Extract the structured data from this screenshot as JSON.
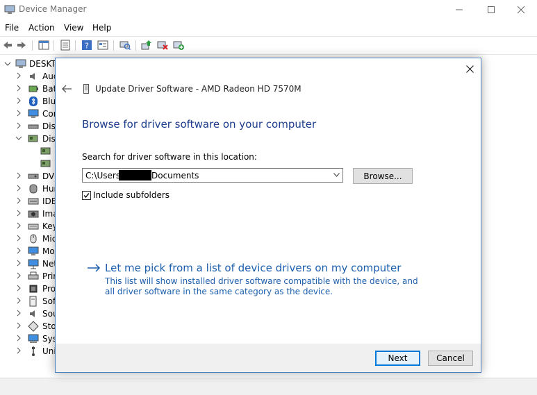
{
  "window": {
    "title": "Device Manager",
    "menu": [
      "File",
      "Action",
      "View",
      "Help"
    ]
  },
  "tree": {
    "root_label": "DESKTO",
    "items": [
      {
        "label": "Aud",
        "icon": "speaker-icon",
        "expanded": false
      },
      {
        "label": "Batt",
        "icon": "battery-icon",
        "expanded": false
      },
      {
        "label": "Blue",
        "icon": "bluetooth-icon",
        "expanded": false
      },
      {
        "label": "Con",
        "icon": "monitor-icon",
        "expanded": false
      },
      {
        "label": "Disk",
        "icon": "disk-drive-icon",
        "expanded": false
      },
      {
        "label": "Disp",
        "icon": "display-adapter-icon",
        "expanded": true
      },
      {
        "label": "",
        "icon": "display-adapter-icon",
        "expanded": null
      },
      {
        "label": "",
        "icon": "display-adapter-icon",
        "expanded": null
      },
      {
        "label": "DVD",
        "icon": "dvd-drive-icon",
        "expanded": false
      },
      {
        "label": "Hum",
        "icon": "human-interface-icon",
        "expanded": false
      },
      {
        "label": "IDE",
        "icon": "ide-controller-icon",
        "expanded": false
      },
      {
        "label": "Ima",
        "icon": "camera-icon",
        "expanded": false
      },
      {
        "label": "Key",
        "icon": "keyboard-icon",
        "expanded": false
      },
      {
        "label": "Mic",
        "icon": "mouse-icon",
        "expanded": false
      },
      {
        "label": "Mo",
        "icon": "monitor-icon",
        "expanded": false
      },
      {
        "label": "Net",
        "icon": "network-adapter-icon",
        "expanded": false
      },
      {
        "label": "Prin",
        "icon": "printer-icon",
        "expanded": false
      },
      {
        "label": "Pro",
        "icon": "processor-icon",
        "expanded": false
      },
      {
        "label": "Soft",
        "icon": "software-device-icon",
        "expanded": false
      },
      {
        "label": "Sou",
        "icon": "speaker-icon",
        "expanded": false
      },
      {
        "label": "Stor",
        "icon": "storage-controller-icon",
        "expanded": false
      },
      {
        "label": "Syst",
        "icon": "system-device-icon",
        "expanded": false
      },
      {
        "label": "Univ",
        "icon": "usb-icon",
        "expanded": false
      }
    ]
  },
  "dialog": {
    "header_title": "Update Driver Software - AMD Radeon HD 7570M",
    "heading": "Browse for driver software on your computer",
    "search_label": "Search for driver software in this location:",
    "path_prefix": "C:\\Users\\",
    "path_suffix": "Documents",
    "browse_label": "Browse...",
    "include_subfolders_label": "Include subfolders",
    "include_subfolders_checked": true,
    "pick_link": "Let me pick from a list of device drivers on my computer",
    "pick_description": "This list will show installed driver software compatible with the device, and all driver software in the same category as the device.",
    "next_label": "Next",
    "cancel_label": "Cancel"
  },
  "colors": {
    "accent": "#0078d7",
    "heading": "#1c3c8c",
    "link": "#1c5fae"
  }
}
